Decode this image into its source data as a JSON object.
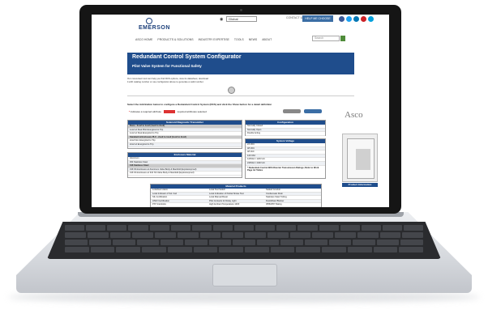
{
  "header": {
    "logo": "EMERSON",
    "language_select": "Global",
    "contact": "CONTACT US",
    "help_button": "HELP ME CHOOSE",
    "search_placeholder": "Search"
  },
  "nav": [
    "ASCO HOME",
    "PRODUCTS & SOLUTIONS",
    "INDUSTRY EXPERTISE",
    "TOOLS",
    "NEWS",
    "ABOUT"
  ],
  "banner": {
    "title": "Redundant Control System Configurator",
    "subtitle": "Pilot Valve System for Functional Safety"
  },
  "intro": {
    "line1": "Our convenient tool can help you find RCS options, view its datasheet, download",
    "line2": "it with catalog number or use configurator above to generate a valid number."
  },
  "instructions": "Select the Add Button below to configure a Redundant Control System (RCS) and click the Show button for a detail definition",
  "required_note": "indicates a required attribute",
  "required_suffix": "required attributes selected",
  "brand": "Asco",
  "solenoid_table": {
    "header": "Solenoid Diagnostic Transmitter",
    "rows": [
      {
        "text": "None - 2oo2 to 1oo2 (1oo2 to 2oo2)",
        "sub": true
      },
      {
        "text": "1oo2 w/ Dual Pilot Energized to Trip",
        "sub": false
      },
      {
        "text": "1oo2 w/ Dual Energized to Trip",
        "sub": false
      },
      {
        "text": "Standard & Enclosure PLC - 2oo2 to 1oo2 (1oo2 to 2oo2)",
        "sub": true
      },
      {
        "text": "2oo2 Non Energized to Trip",
        "sub": false
      },
      {
        "text": "2oo2 w/ Energized to Trip",
        "sub": false
      }
    ]
  },
  "enclosure_table": {
    "header": "Enclosure Material",
    "rows": [
      {
        "text": "Aluminum",
        "sub": false
      },
      {
        "text": "304 Stainless Steel",
        "sub": false
      },
      {
        "text": "316 Stainless Steel",
        "sub": true
      },
      {
        "text": "316 SS Enclosure w/ Aluminum Valve Body & Manifold (Explosionproof)",
        "sub": false
      },
      {
        "text": "316 SS Enclosure w/ 316 SS Valve Body & Manifold (Explosionproof)",
        "sub": false
      }
    ]
  },
  "config_table": {
    "header": "Configuration",
    "rows": [
      {
        "text": "Normally Closed",
        "sub": false
      },
      {
        "text": "Normally Open",
        "sub": false
      },
      {
        "text": "Double Acting",
        "sub": false
      }
    ]
  },
  "voltage_table": {
    "header": "System Voltage",
    "rows": [
      {
        "text": "24 VDC",
        "sub": false
      },
      {
        "text": "48 VDC",
        "sub": false
      },
      {
        "text": "48 VAC",
        "sub": false
      },
      {
        "text": "120 VAC",
        "sub": false
      },
      {
        "text": "120VAC / 120V AC",
        "sub": false
      },
      {
        "text": "240VAC / 240V AC",
        "sub": false
      }
    ],
    "note": "* Redundant Control With Diverter Transmission Ratings; Refer to Work Page Air Tables"
  },
  "product_info": "Product Information",
  "material_table": {
    "header": "Material Products",
    "columns": [
      [
        "Lockdown Alarm",
        "Local Indicator of Sol. Fail",
        "SIL Certification",
        "ATEX Certification",
        "PST Interlocks"
      ],
      [
        "Local Test Switch",
        "Local Indication of Partial Stroke Test",
        "Local Manual Reset",
        "Pilot Contacts for Relay Light",
        "High Ambient Temperature 140F"
      ],
      [
        "Sealed Conduit",
        "Condensate Drain",
        "Stainless Steel Tubing",
        "Dust/Water Blocker",
        "IP66/IP67 Rating"
      ]
    ]
  },
  "colors": {
    "accent": "#1f4d8c",
    "button": "#3b6ea5",
    "required": "#dd3333",
    "social": [
      "#3b5998",
      "#1da1f2",
      "#0077b5",
      "#cc2127",
      "#00a0dc"
    ]
  }
}
